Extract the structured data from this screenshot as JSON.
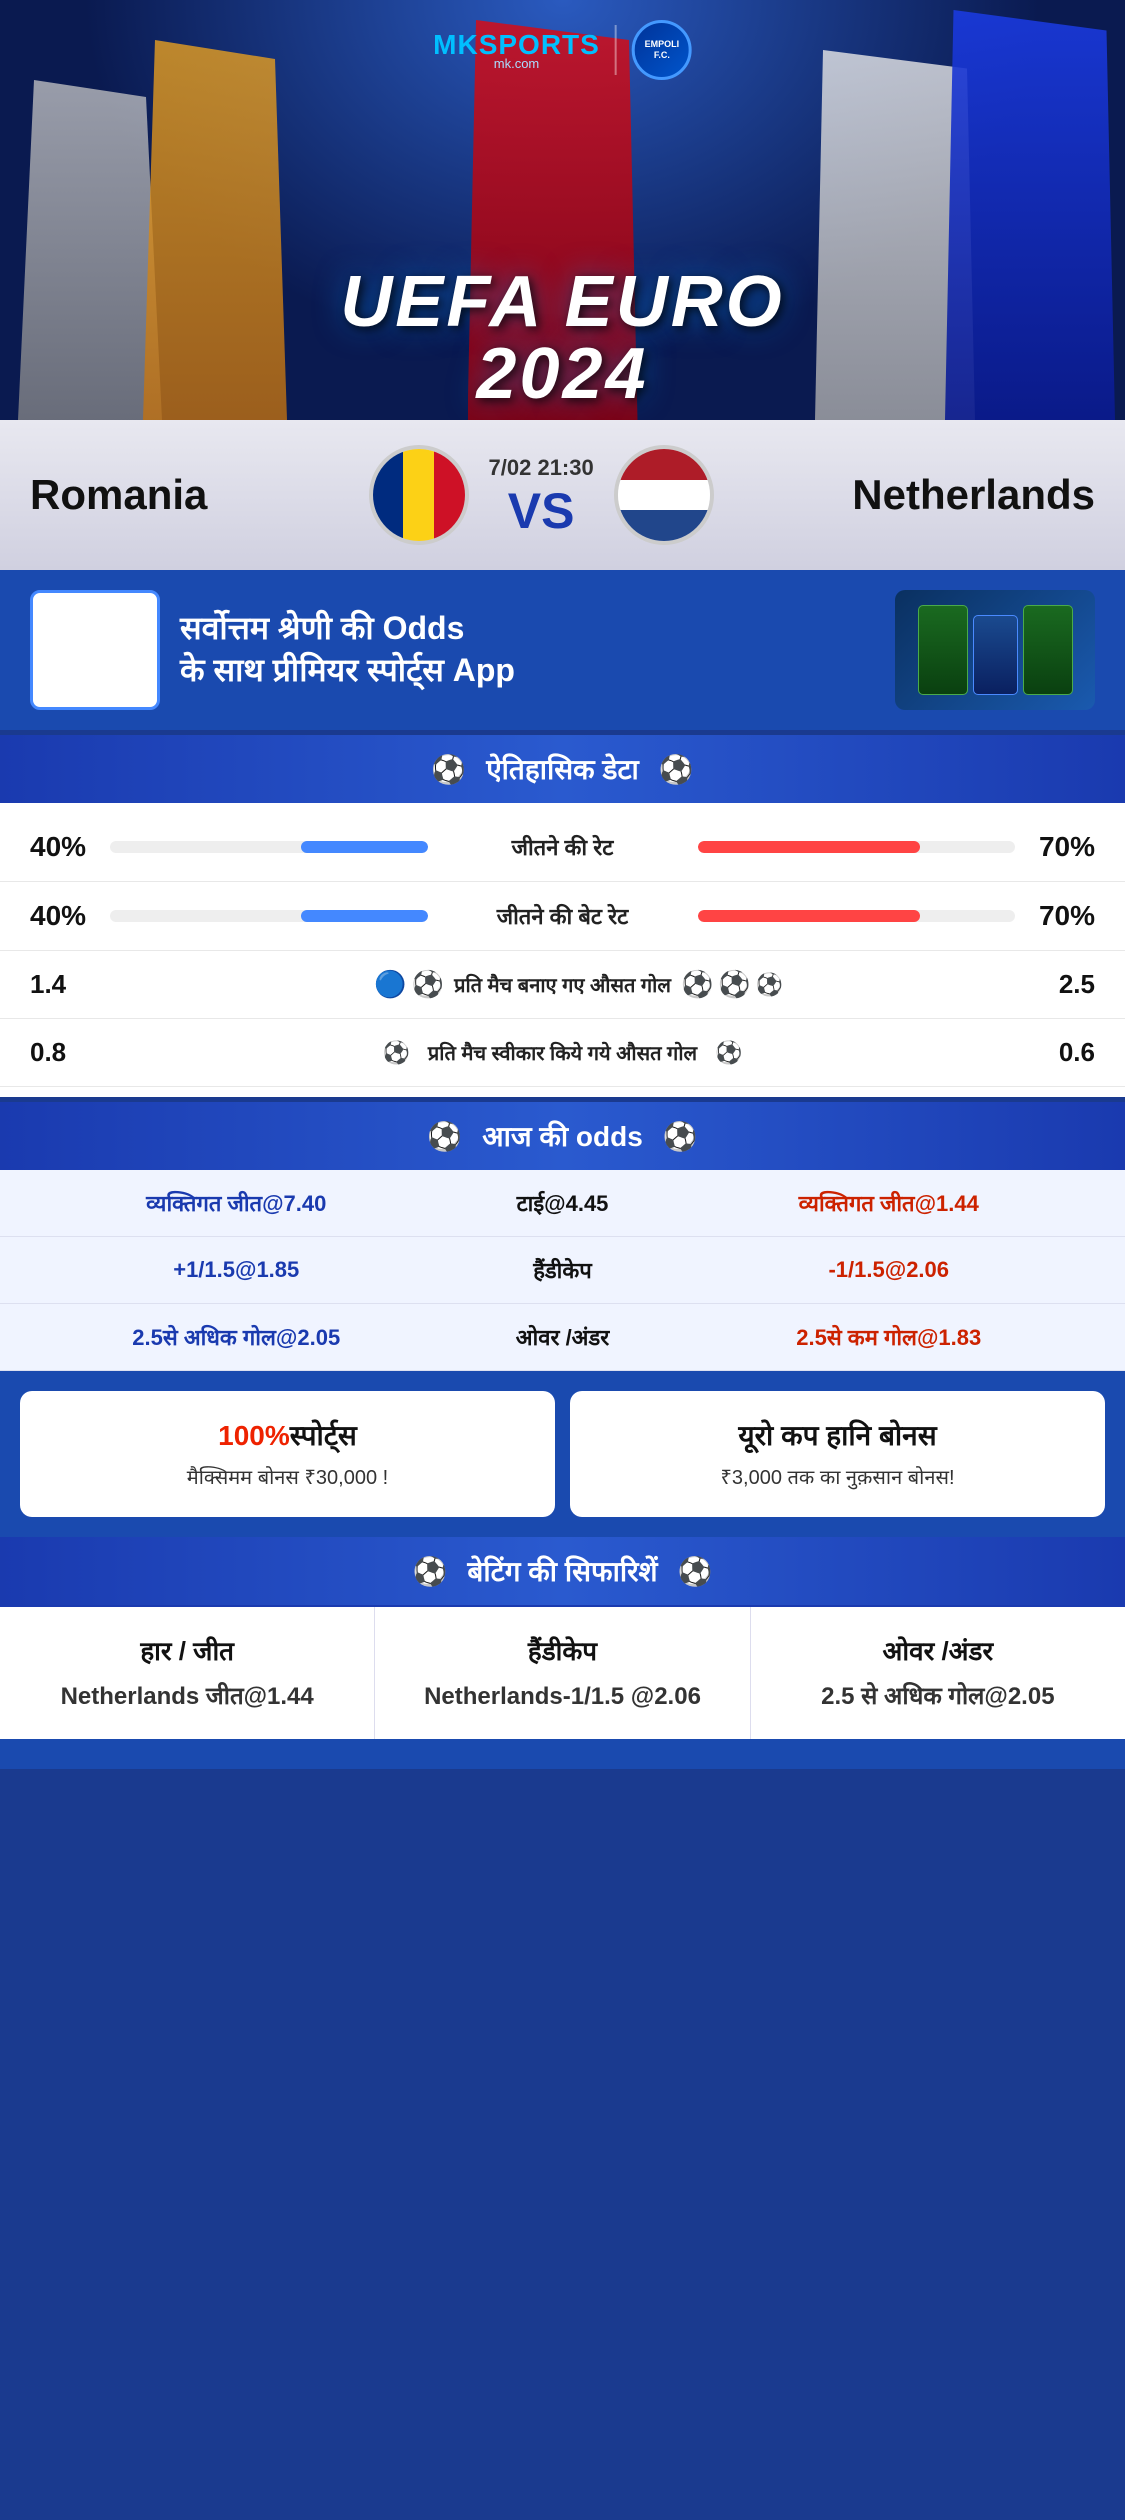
{
  "header": {
    "logo_mk": "MK",
    "logo_sports": "SPORTS",
    "logo_domain": "mk.com",
    "euro_title": "UEFA EURO 2024"
  },
  "match": {
    "team_left": "Romania",
    "team_right": "Netherlands",
    "date": "7/02 21:30",
    "vs": "VS"
  },
  "promo": {
    "headline": "सर्वोत्तम श्रेणी की",
    "odds_word": "Odds",
    "headline2": "के साथ प्रीमियर स्पोर्ट्स",
    "app_word": "App"
  },
  "historical": {
    "section_title": "ऐतिहासिक डेटा",
    "stats": [
      {
        "label": "जीतने की रेट",
        "left_val": "40%",
        "right_val": "70%",
        "left_pct": 40,
        "right_pct": 70
      },
      {
        "label": "जीतने की बेट रेट",
        "left_val": "40%",
        "right_val": "70%",
        "left_pct": 40,
        "right_pct": 70
      }
    ],
    "goal_stats": [
      {
        "label": "प्रति मैच बनाए गए औसत गोल",
        "left_val": "1.4",
        "right_val": "2.5",
        "left_icons": 2,
        "right_icons": 3
      },
      {
        "label": "प्रति मैच स्वीकार किये गये औसत गोल",
        "left_val": "0.8",
        "right_val": "0.6",
        "left_icons": 1,
        "right_icons": 1
      }
    ]
  },
  "odds": {
    "section_title": "आज की odds",
    "rows": [
      {
        "left": "व्यक्तिगत जीत@7.40",
        "center": "टाई@4.45",
        "right": "व्यक्तिगत जीत@1.44"
      },
      {
        "left": "+1/1.5@1.85",
        "center": "हैंडीकेप",
        "right": "-1/1.5@2.06"
      },
      {
        "left": "2.5से अधिक गोल@2.05",
        "center": "ओवर /अंडर",
        "right": "2.5से कम गोल@1.83"
      }
    ]
  },
  "bonus": {
    "card1": {
      "title_red": "100%",
      "title_normal": "स्पोर्ट्स",
      "subtitle": "मैक्सिमम बोनस  ₹30,000 !"
    },
    "card2": {
      "title": "यूरो कप हानि बोनस",
      "subtitle": "₹3,000 तक का नुक़सान बोनस!"
    }
  },
  "recommendations": {
    "section_title": "बेटिंग की सिफारिशें",
    "cols": [
      {
        "title": "हार / जीत",
        "value": "Netherlands जीत@1.44"
      },
      {
        "title": "हैंडीकेप",
        "value": "Netherlands-1/1.5 @2.06"
      },
      {
        "title": "ओवर /अंडर",
        "value": "2.5 से अधिक गोल@2.05"
      }
    ]
  }
}
